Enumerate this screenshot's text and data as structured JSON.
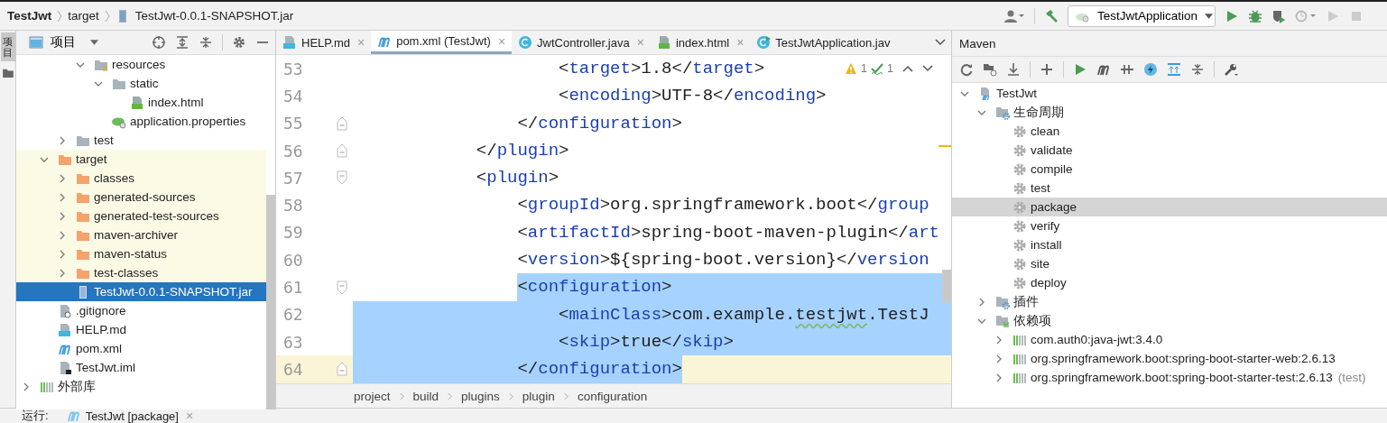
{
  "navbar": {
    "breadcrumb": [
      {
        "label": "TestJwt",
        "kind": "project"
      },
      {
        "label": "target",
        "kind": "folder"
      },
      {
        "label": "TestJwt-0.0.1-SNAPSHOT.jar",
        "kind": "jar"
      }
    ],
    "run_configuration": "TestJwtApplication"
  },
  "side_stripe": {
    "tabs": [
      {
        "label": "项目",
        "selected": true
      }
    ]
  },
  "project_panel": {
    "title": "项目",
    "tree": [
      {
        "children": [
          {
            "children": [
              {
                "children": [
                  {
                    "label": "resources",
                    "kind": "resources-folder",
                    "expanded": true,
                    "selected": false,
                    "children": [
                      {
                        "label": "static",
                        "kind": "folder",
                        "expanded": true,
                        "selected": false,
                        "children": [
                          {
                            "label": "index.html",
                            "kind": "html",
                            "selected": false
                          }
                        ]
                      },
                      {
                        "label": "application.properties",
                        "kind": "properties",
                        "selected": false
                      }
                    ]
                  }
                ]
              },
              {
                "label": "test",
                "kind": "folder",
                "expanded": false,
                "selected": false
              }
            ]
          },
          {
            "label": "target",
            "kind": "folder",
            "expanded": true,
            "excluded": true,
            "selected": false,
            "children": [
              {
                "label": "classes",
                "kind": "folder",
                "expanded": false,
                "excluded": true,
                "selected": false
              },
              {
                "label": "generated-sources",
                "kind": "folder",
                "expanded": false,
                "excluded": true,
                "selected": false
              },
              {
                "label": "generated-test-sources",
                "kind": "folder",
                "expanded": false,
                "excluded": true,
                "selected": false
              },
              {
                "label": "maven-archiver",
                "kind": "folder",
                "expanded": false,
                "excluded": true,
                "selected": false
              },
              {
                "label": "maven-status",
                "kind": "folder",
                "expanded": false,
                "excluded": true,
                "selected": false
              },
              {
                "label": "test-classes",
                "kind": "folder",
                "expanded": false,
                "excluded": true,
                "selected": false
              },
              {
                "label": "TestJwt-0.0.1-SNAPSHOT.jar",
                "kind": "jar",
                "selected": true
              }
            ]
          },
          {
            "label": ".gitignore",
            "kind": "gitignore",
            "selected": false
          },
          {
            "label": "HELP.md",
            "kind": "md",
            "selected": false
          },
          {
            "label": "pom.xml",
            "kind": "maven",
            "selected": false
          },
          {
            "label": "TestJwt.iml",
            "kind": "iml",
            "selected": false
          }
        ]
      },
      {
        "label": "外部库",
        "kind": "library",
        "expanded": false,
        "selected": false
      }
    ]
  },
  "editor": {
    "tabs": [
      {
        "label": "HELP.md",
        "kind": "md",
        "close": "×",
        "selected": false
      },
      {
        "label": "pom.xml (TestJwt)",
        "kind": "maven",
        "close": "×",
        "selected": true
      },
      {
        "label": "JwtController.java",
        "kind": "class",
        "close": "×",
        "selected": false
      },
      {
        "label": "index.html",
        "kind": "html",
        "close": "×",
        "selected": false
      },
      {
        "label": "TestJwtApplication.jav",
        "kind": "app-class",
        "selected": false
      }
    ],
    "inspections": {
      "warnings": "1",
      "typos": "1"
    },
    "lines": [
      {
        "number": "53",
        "kind": "plain",
        "segments": [
          {
            "kind": "plain",
            "text": "                    <"
          },
          {
            "kind": "tag",
            "text": "target"
          },
          {
            "kind": "plain",
            "text": ">1.8</"
          },
          {
            "kind": "tag",
            "text": "target"
          },
          {
            "kind": "plain",
            "text": ">"
          }
        ]
      },
      {
        "number": "54",
        "kind": "plain",
        "segments": [
          {
            "kind": "plain",
            "text": "                    <"
          },
          {
            "kind": "tag",
            "text": "encoding"
          },
          {
            "kind": "plain",
            "text": ">UTF-8</"
          },
          {
            "kind": "tag",
            "text": "encoding"
          },
          {
            "kind": "plain",
            "text": ">"
          }
        ]
      },
      {
        "number": "55",
        "kind": "plain",
        "fold_end": true,
        "segments": [
          {
            "kind": "plain",
            "text": "                </"
          },
          {
            "kind": "tag",
            "text": "configuration"
          },
          {
            "kind": "plain",
            "text": ">"
          }
        ]
      },
      {
        "number": "56",
        "kind": "plain",
        "fold_end": true,
        "segments": [
          {
            "kind": "plain",
            "text": "            </"
          },
          {
            "kind": "tag",
            "text": "plugin"
          },
          {
            "kind": "plain",
            "text": ">"
          }
        ]
      },
      {
        "number": "57",
        "kind": "plain",
        "fold_start": true,
        "segments": [
          {
            "kind": "plain",
            "text": "            <"
          },
          {
            "kind": "tag",
            "text": "plugin"
          },
          {
            "kind": "plain",
            "text": ">"
          }
        ]
      },
      {
        "number": "58",
        "kind": "plain",
        "segments": [
          {
            "kind": "plain",
            "text": "                <"
          },
          {
            "kind": "tag",
            "text": "groupId"
          },
          {
            "kind": "plain",
            "text": ">org.springframework.boot</"
          },
          {
            "kind": "tag",
            "text": "group"
          }
        ]
      },
      {
        "number": "59",
        "kind": "plain",
        "segments": [
          {
            "kind": "plain",
            "text": "                <"
          },
          {
            "kind": "tag",
            "text": "artifactId"
          },
          {
            "kind": "plain",
            "text": ">spring-boot-maven-plugin</"
          },
          {
            "kind": "tag",
            "text": "art"
          }
        ]
      },
      {
        "number": "60",
        "kind": "plain",
        "segments": [
          {
            "kind": "plain",
            "text": "                <"
          },
          {
            "kind": "tag",
            "text": "version"
          },
          {
            "kind": "plain",
            "text": ">${spring-boot.version}</"
          },
          {
            "kind": "tag",
            "text": "version"
          }
        ]
      },
      {
        "number": "61",
        "kind": "selection-start",
        "fold_start": true,
        "segments": [
          {
            "kind": "plain",
            "text": "                <"
          },
          {
            "kind": "tag",
            "text": "configuration"
          },
          {
            "kind": "plain",
            "text": ">"
          }
        ]
      },
      {
        "number": "62",
        "kind": "selected",
        "segments": [
          {
            "kind": "plain",
            "text": "                    <"
          },
          {
            "kind": "tag",
            "text": "mainClass"
          },
          {
            "kind": "plain",
            "text": ">com.example."
          },
          {
            "kind": "typo",
            "text": "testjwt"
          },
          {
            "kind": "plain",
            "text": ".TestJ"
          }
        ]
      },
      {
        "number": "63",
        "kind": "selected",
        "segments": [
          {
            "kind": "plain",
            "text": "                    <"
          },
          {
            "kind": "tag",
            "text": "skip"
          },
          {
            "kind": "plain",
            "text": ">true</"
          },
          {
            "kind": "tag",
            "text": "skip"
          },
          {
            "kind": "plain",
            "text": ">"
          }
        ]
      },
      {
        "number": "64",
        "kind": "selection-end",
        "current": true,
        "fold_end": true,
        "segments": [
          {
            "kind": "plain",
            "text": "                </"
          },
          {
            "kind": "tag",
            "text": "configuration"
          },
          {
            "kind": "plain",
            "text": ">"
          }
        ]
      }
    ],
    "breadcrumb": [
      "project",
      "build",
      "plugins",
      "plugin",
      "configuration"
    ]
  },
  "maven_panel": {
    "title": "Maven",
    "tree": [
      {
        "label": "TestJwt",
        "kind": "maven-module",
        "expanded": true,
        "selected": false,
        "children": [
          {
            "label": "生命周期",
            "kind": "lifecycle-folder",
            "expanded": true,
            "selected": false,
            "children": [
              {
                "label": "clean",
                "kind": "gear",
                "selected": false
              },
              {
                "label": "validate",
                "kind": "gear",
                "selected": false
              },
              {
                "label": "compile",
                "kind": "gear",
                "selected": false
              },
              {
                "label": "test",
                "kind": "gear",
                "selected": false
              },
              {
                "label": "package",
                "kind": "gear",
                "selected": true
              },
              {
                "label": "verify",
                "kind": "gear",
                "selected": false
              },
              {
                "label": "install",
                "kind": "gear",
                "selected": false
              },
              {
                "label": "site",
                "kind": "gear",
                "selected": false
              },
              {
                "label": "deploy",
                "kind": "gear",
                "selected": false
              }
            ]
          },
          {
            "label": "插件",
            "kind": "plugin-folder",
            "expanded": false,
            "selected": false
          },
          {
            "label": "依赖项",
            "kind": "dependency-folder",
            "expanded": true,
            "selected": false,
            "children": [
              {
                "label": "com.auth0:java-jwt:3.4.0",
                "kind": "library",
                "expanded": false,
                "selected": false
              },
              {
                "label": "org.springframework.boot:spring-boot-starter-web:2.6.13",
                "kind": "library",
                "expanded": false,
                "selected": false
              },
              {
                "label": "org.springframework.boot:spring-boot-starter-test:2.6.13",
                "kind": "library",
                "expanded": false,
                "selected": false,
                "suffix": "(test)"
              }
            ]
          }
        ]
      }
    ]
  },
  "run_bar": {
    "label": "运行:",
    "tab": "TestJwt [package]",
    "close": "×"
  }
}
